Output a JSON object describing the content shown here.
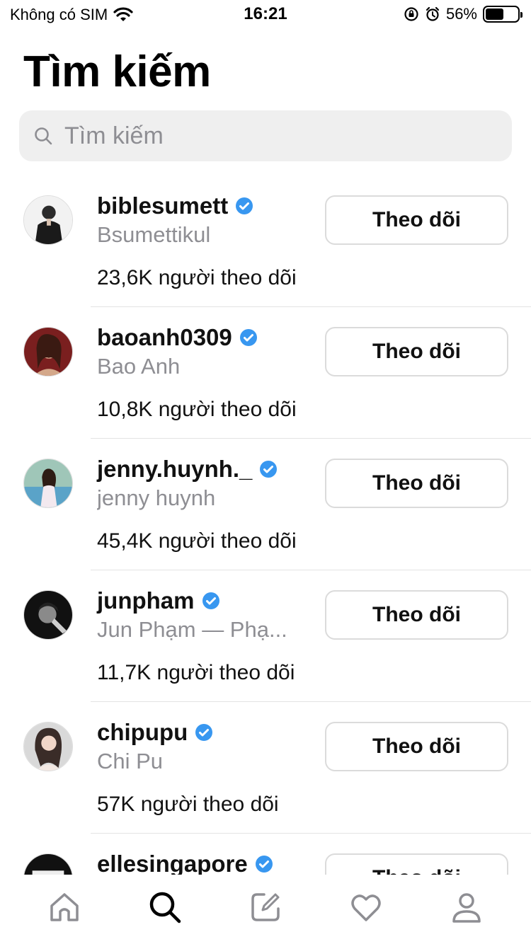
{
  "status_bar": {
    "carrier": "Không có SIM",
    "time": "16:21",
    "battery": "56%",
    "battery_level": 0.56
  },
  "header": {
    "title": "Tìm kiếm",
    "search_placeholder": "Tìm kiếm"
  },
  "results": [
    {
      "username": "biblesumett",
      "full_name": "Bsumettikul",
      "followers": "23,6K người theo dõi",
      "button": "Theo dõi",
      "verified": true
    },
    {
      "username": "baoanh0309",
      "full_name": "Bao Anh",
      "followers": "10,8K người theo dõi",
      "button": "Theo dõi",
      "verified": true
    },
    {
      "username": "jenny.huynh._",
      "full_name": "jenny huynh",
      "followers": "45,4K người theo dõi",
      "button": "Theo dõi",
      "verified": true
    },
    {
      "username": "junpham",
      "full_name": "Jun Phạm — Phạ...",
      "followers": "11,7K người theo dõi",
      "button": "Theo dõi",
      "verified": true
    },
    {
      "username": "chipupu",
      "full_name": "Chi Pu",
      "followers": "57K người theo dõi",
      "button": "Theo dõi",
      "verified": true
    },
    {
      "username": "ellesingapore",
      "full_name": "",
      "followers": "",
      "button": "Theo dõi",
      "verified": true
    }
  ],
  "tab_bar": {
    "icons": [
      "home-icon",
      "search-icon",
      "compose-icon",
      "heart-icon",
      "profile-icon"
    ],
    "active": "search-icon"
  },
  "colors": {
    "verified": "#3897f0",
    "secondary_text": "#8e8e93",
    "search_bg": "#efefef"
  }
}
